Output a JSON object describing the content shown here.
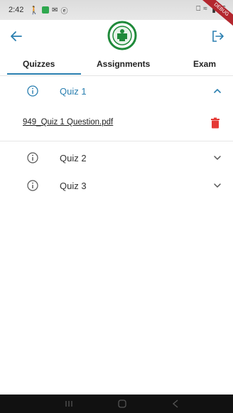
{
  "status": {
    "time": "2:42",
    "right_text": "46",
    "debug_banner": "DEBUG"
  },
  "icons": {
    "back": "arrow-left-icon",
    "logo": "emblem-logo",
    "logout": "logout-icon",
    "info": "info-icon",
    "expand": "chevron-down-icon",
    "collapse": "chevron-up-icon",
    "delete": "trash-icon"
  },
  "colors": {
    "accent": "#2a7fb0",
    "logo_green": "#1f8a3a",
    "delete_red": "#e53935"
  },
  "tabs": [
    {
      "label": "Quizzes",
      "selected": true
    },
    {
      "label": "Assignments",
      "selected": false
    },
    {
      "label": "Exam",
      "selected": false
    }
  ],
  "quizzes": [
    {
      "label": "Quiz 1",
      "expanded": true,
      "file": "949_Quiz 1 Question.pdf"
    },
    {
      "label": "Quiz 2",
      "expanded": false
    },
    {
      "label": "Quiz 3",
      "expanded": false
    }
  ]
}
